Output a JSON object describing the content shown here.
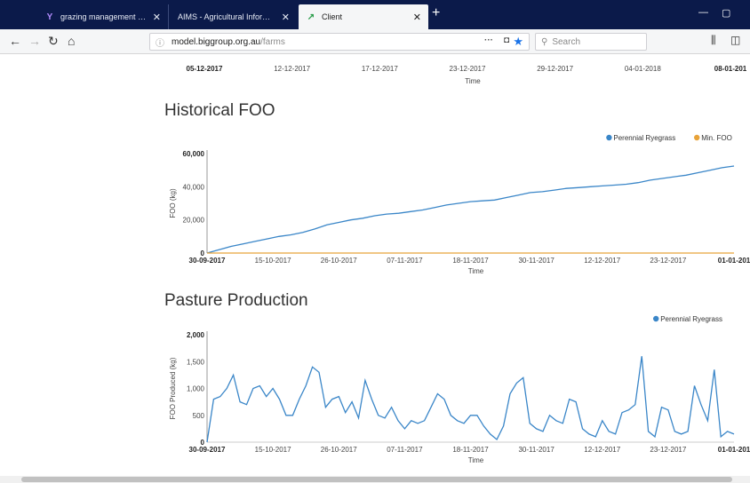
{
  "browser": {
    "tabs": [
      {
        "title": "grazing management tools - Y",
        "icon": "yahoo-icon",
        "active": false
      },
      {
        "title": "AIMS - Agricultural Information ar",
        "icon": "page-icon",
        "active": false
      },
      {
        "title": "Client",
        "icon": "client-logo-icon",
        "active": true
      }
    ],
    "url_domain": "model.biggroup.org.au",
    "url_path": "/farms",
    "search_placeholder": "Search",
    "colors": {
      "titlebar": "#0b1a4a",
      "accent": "#1a73e8"
    }
  },
  "top_axis": {
    "ticks": [
      "05-12-2017",
      "12-12-2017",
      "17-12-2017",
      "23-12-2017",
      "29-12-2017",
      "04-01-2018",
      "08-01-201"
    ],
    "xlabel": "Time"
  },
  "chart_data": [
    {
      "type": "line",
      "title": "Historical FOO",
      "xlabel": "Time",
      "ylabel": "FOO (kg)",
      "ylim": [
        0,
        60000
      ],
      "yticks": [
        "0",
        "20,000",
        "40,000",
        "60,000"
      ],
      "xticks": [
        "30-09-2017",
        "15-10-2017",
        "26-10-2017",
        "07-11-2017",
        "18-11-2017",
        "30-11-2017",
        "12-12-2017",
        "23-12-2017",
        "01-01-201"
      ],
      "legend": "top-right",
      "series": [
        {
          "name": "Perennial Ryegrass",
          "color": "#3a86c8",
          "values": [
            0,
            2000,
            4000,
            5500,
            7000,
            8500,
            10000,
            11000,
            12500,
            14500,
            17000,
            18500,
            20000,
            21000,
            22500,
            23500,
            24000,
            25000,
            26000,
            27500,
            29000,
            30000,
            31000,
            31500,
            32000,
            33500,
            35000,
            36500,
            37000,
            38000,
            39000,
            39500,
            40000,
            40500,
            41000,
            41500,
            42500,
            44000,
            45000,
            46000,
            47000,
            48500,
            50000,
            51500,
            52500
          ]
        },
        {
          "name": "Min. FOO",
          "color": "#e8a33a",
          "values": [
            0,
            0,
            0,
            0,
            0,
            0,
            0,
            0,
            0,
            0,
            0,
            0,
            0,
            0,
            0,
            0,
            0,
            0,
            0,
            0,
            0,
            0,
            0,
            0,
            0,
            0,
            0,
            0,
            0,
            0,
            0,
            0,
            0,
            0,
            0,
            0,
            0,
            0,
            0,
            0,
            0,
            0,
            0,
            0,
            0
          ]
        }
      ]
    },
    {
      "type": "line",
      "title": "Pasture Production",
      "xlabel": "Time",
      "ylabel": "FOO Produced (kg)",
      "ylim": [
        0,
        2000
      ],
      "yticks": [
        "0",
        "500",
        "1,000",
        "1,500",
        "2,000"
      ],
      "xticks": [
        "30-09-2017",
        "15-10-2017",
        "26-10-2017",
        "07-11-2017",
        "18-11-2017",
        "30-11-2017",
        "12-12-2017",
        "23-12-2017",
        "01-01-201"
      ],
      "legend": "top-right",
      "series": [
        {
          "name": "Perennial Ryegrass",
          "color": "#3a86c8",
          "values": [
            0,
            800,
            850,
            1000,
            1250,
            750,
            700,
            1000,
            1050,
            850,
            1000,
            800,
            500,
            500,
            800,
            1050,
            1400,
            1300,
            650,
            800,
            850,
            550,
            750,
            450,
            1150,
            800,
            500,
            450,
            650,
            400,
            250,
            400,
            350,
            400,
            650,
            900,
            800,
            500,
            400,
            350,
            500,
            500,
            300,
            150,
            50,
            300,
            900,
            1100,
            1200,
            350,
            250,
            200,
            500,
            400,
            350,
            800,
            750,
            250,
            150,
            100,
            400,
            200,
            150,
            550,
            600,
            700,
            1600,
            200,
            100,
            650,
            600,
            200,
            150,
            200,
            1050,
            700,
            400,
            1350,
            100,
            200,
            150
          ]
        }
      ]
    }
  ]
}
